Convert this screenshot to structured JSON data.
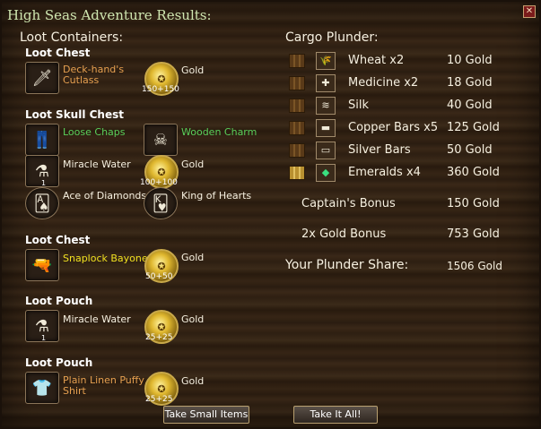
{
  "window": {
    "title": "High Seas Adventure Results:",
    "close_glyph": "✕"
  },
  "loot": {
    "header": "Loot Containers:",
    "containers": [
      {
        "name": "Loot Chest",
        "items": [
          {
            "label": "Deck-hand's\nCutlass",
            "icon": "sword-icon"
          },
          {
            "label": "Gold",
            "amount": "150+150",
            "icon": "gold-coin-icon"
          }
        ]
      },
      {
        "name": "Loot Skull Chest",
        "items": [
          {
            "label": "Loose Chaps",
            "icon": "pants-icon"
          },
          {
            "label": "Wooden Charm",
            "icon": "skull-charm-icon"
          },
          {
            "label": "Miracle Water",
            "qty": "1",
            "icon": "potion-icon"
          },
          {
            "label": "Gold",
            "amount": "100+100",
            "icon": "gold-coin-icon"
          },
          {
            "label": "Ace of Diamonds",
            "icon": "card-icon"
          },
          {
            "label": "King of Hearts",
            "icon": "card-icon"
          }
        ]
      },
      {
        "name": "Loot Chest",
        "items": [
          {
            "label": "Snaplock Bayonet",
            "icon": "musket-icon"
          },
          {
            "label": "Gold",
            "amount": "50+50",
            "icon": "gold-coin-icon"
          }
        ]
      },
      {
        "name": "Loot Pouch",
        "items": [
          {
            "label": "Miracle Water",
            "qty": "1",
            "icon": "potion-icon"
          },
          {
            "label": "Gold",
            "amount": "25+25",
            "icon": "gold-coin-icon"
          }
        ]
      },
      {
        "name": "Loot Pouch",
        "items": [
          {
            "label": "Plain Linen Puffy\nShirt",
            "icon": "shirt-icon"
          },
          {
            "label": "Gold",
            "amount": "25+25",
            "icon": "gold-coin-icon"
          }
        ]
      }
    ]
  },
  "cargo": {
    "header": "Cargo Plunder:",
    "rows": [
      {
        "name": "Wheat x2",
        "value": "10 Gold"
      },
      {
        "name": "Medicine x2",
        "value": "18 Gold"
      },
      {
        "name": "Silk",
        "value": "40 Gold"
      },
      {
        "name": "Copper Bars x5",
        "value": "125 Gold"
      },
      {
        "name": "Silver Bars",
        "value": "50 Gold"
      },
      {
        "name": "Emeralds x4",
        "value": "360 Gold"
      }
    ],
    "captains_bonus": {
      "label": "Captain's Bonus",
      "value": "150 Gold"
    },
    "gold_bonus": {
      "label": "2x Gold Bonus",
      "value": "753 Gold"
    },
    "share": {
      "label": "Your Plunder Share:",
      "value": "1506 Gold"
    }
  },
  "buttons": {
    "take_small": "Take Small Items",
    "take_all": "Take It All!"
  }
}
